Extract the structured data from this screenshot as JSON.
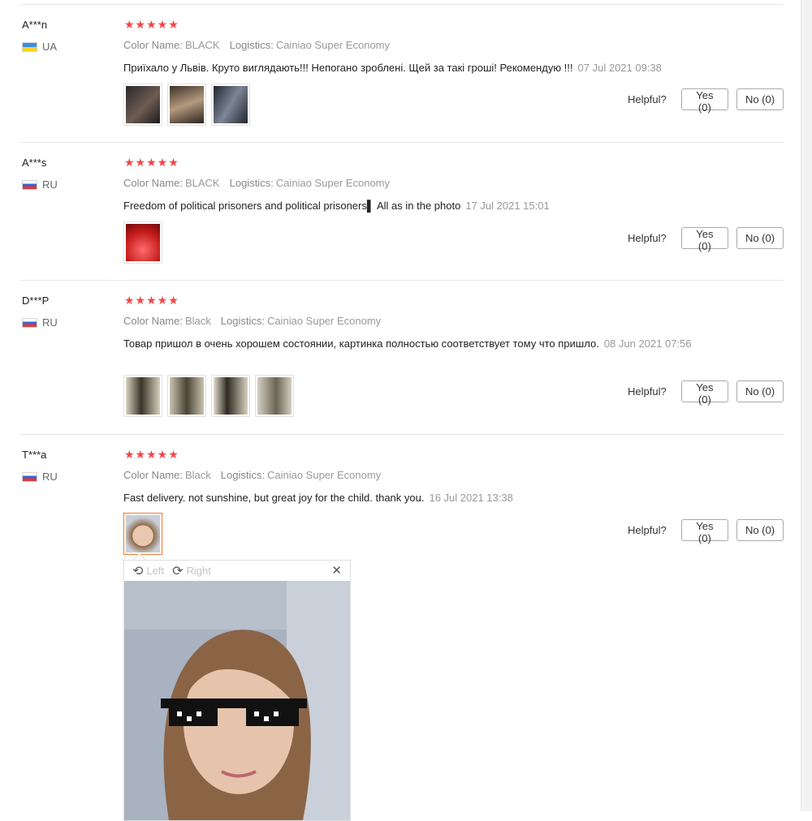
{
  "helpful_label": "Helpful?",
  "reviews": [
    {
      "user": "A***n",
      "country": "UA",
      "stars": "★★★★★",
      "color_key": "Color Name:",
      "color_value": "BLACK",
      "logistics_key": "Logistics:",
      "logistics_value": "Cainiao Super Economy",
      "text": "Приїхало у Львів. Круто виглядають!!! Непогано зроблені. Щей за такі гроші! Рекомендую !!!",
      "date": "07 Jul 2021 09:38",
      "yes": "Yes (0)",
      "no": "No (0)"
    },
    {
      "user": "A***s",
      "country": "RU",
      "stars": "★★★★★",
      "color_key": "Color Name:",
      "color_value": "BLACK",
      "logistics_key": "Logistics:",
      "logistics_value": "Cainiao Super Economy",
      "text": "Freedom of political prisoners and political prisoners▌ All as in the photo",
      "date": "17 Jul 2021 15:01",
      "yes": "Yes (0)",
      "no": "No (0)"
    },
    {
      "user": "D***P",
      "country": "RU",
      "stars": "★★★★★",
      "color_key": "Color Name:",
      "color_value": "Black",
      "logistics_key": "Logistics:",
      "logistics_value": "Cainiao Super Economy",
      "text": "Товар пришол в очень хорошем состоянии, картинка полностью соответствует тому что пришло.",
      "date": "08 Jun 2021 07:56",
      "yes": "Yes (0)",
      "no": "No (0)"
    },
    {
      "user": "T***a",
      "country": "RU",
      "stars": "★★★★★",
      "color_key": "Color Name:",
      "color_value": "Black",
      "logistics_key": "Logistics:",
      "logistics_value": "Cainiao Super Economy",
      "text": "Fast delivery. not sunshine, but great joy for the child. thank you.",
      "date": "16 Jul 2021 13:38",
      "yes": "Yes (0)",
      "no": "No (0)"
    }
  ],
  "viewer": {
    "left_label": "Left",
    "right_label": "Right",
    "left_icon": "rotate-left-icon",
    "right_icon": "rotate-right-icon",
    "close_icon": "close-icon"
  },
  "colors": {
    "star": "#f04848",
    "active_thumb_border": "#f07a2a"
  }
}
